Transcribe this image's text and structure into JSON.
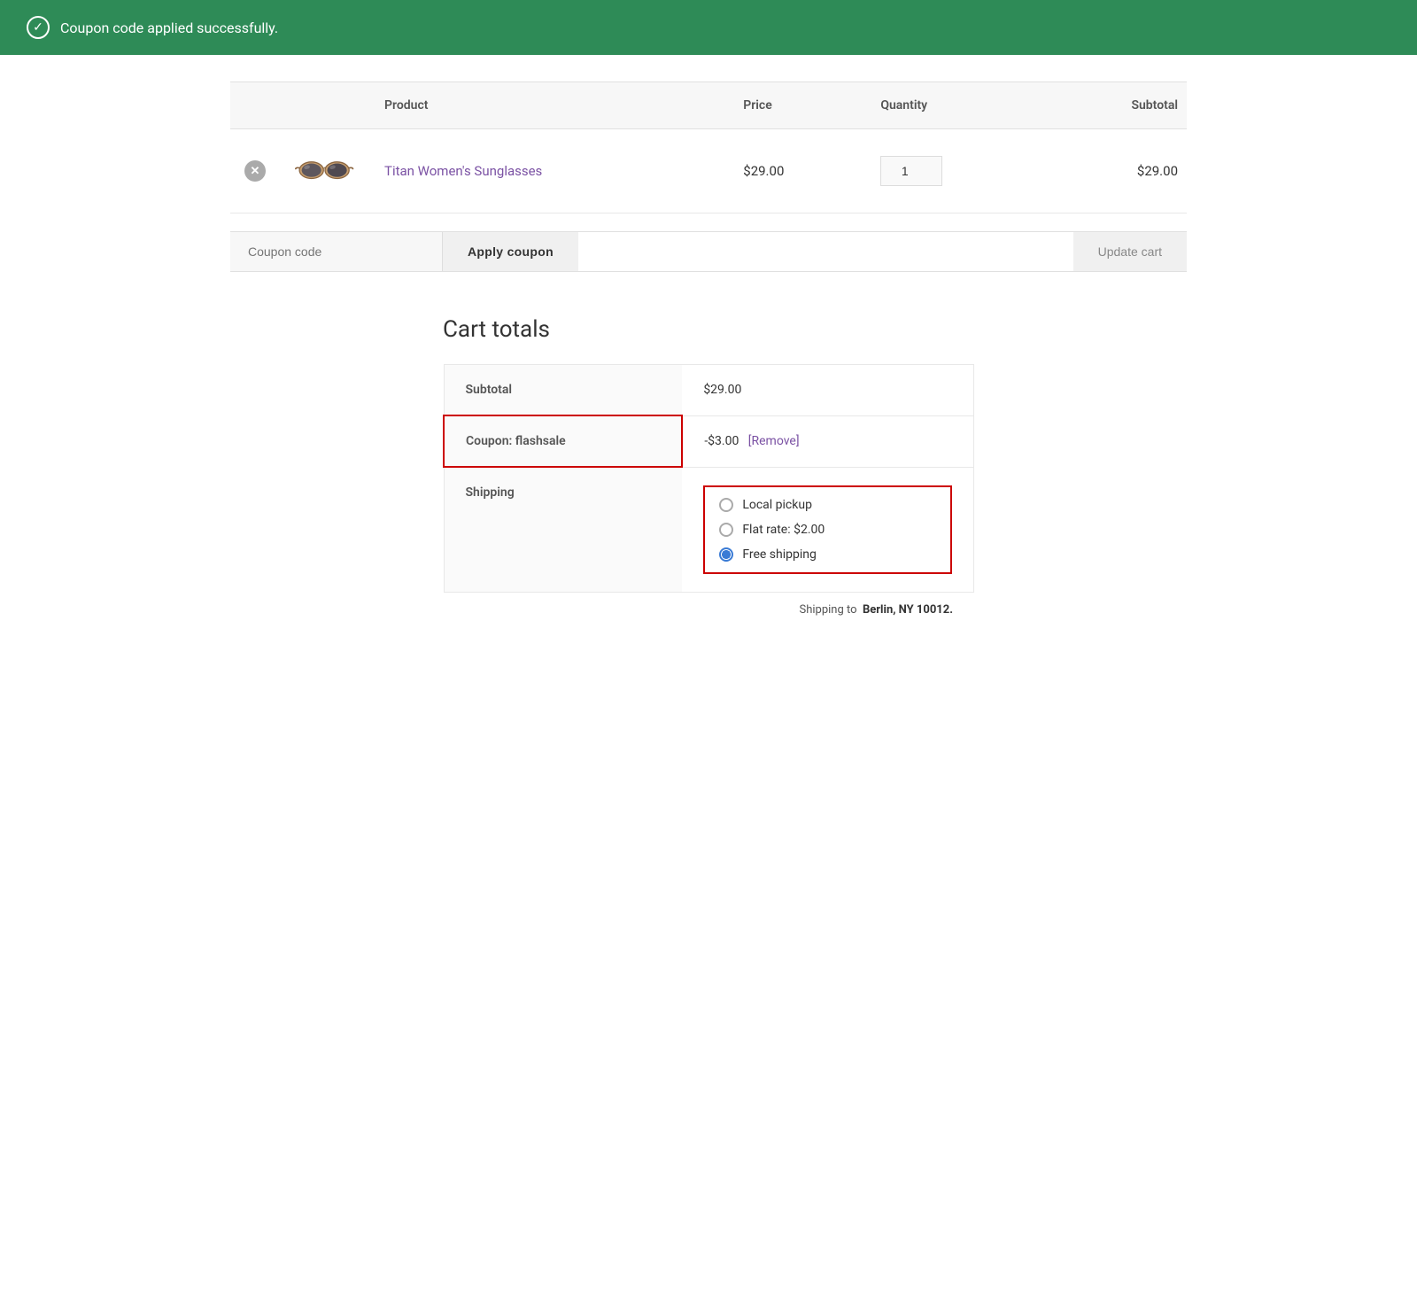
{
  "banner": {
    "message": "Coupon code applied successfully.",
    "icon": "✓"
  },
  "cart": {
    "columns": {
      "product": "Product",
      "price": "Price",
      "quantity": "Quantity",
      "subtotal": "Subtotal"
    },
    "items": [
      {
        "name": "Titan Women's Sunglasses",
        "price": "$29.00",
        "quantity": 1,
        "subtotal": "$29.00"
      }
    ],
    "coupon_placeholder": "Coupon code",
    "apply_coupon_label": "Apply coupon",
    "update_cart_label": "Update cart"
  },
  "cart_totals": {
    "title": "Cart totals",
    "subtotal_label": "Subtotal",
    "subtotal_value": "$29.00",
    "coupon_label": "Coupon: flashsale",
    "coupon_value": "-$3.00",
    "remove_label": "[Remove]",
    "shipping_label": "Shipping",
    "shipping_options": [
      {
        "label": "Local pickup",
        "selected": false
      },
      {
        "label": "Flat rate: $2.00",
        "selected": false
      },
      {
        "label": "Free shipping",
        "selected": true
      }
    ],
    "shipping_to_prefix": "Shipping to",
    "shipping_to_location": "Berlin, NY 10012."
  }
}
